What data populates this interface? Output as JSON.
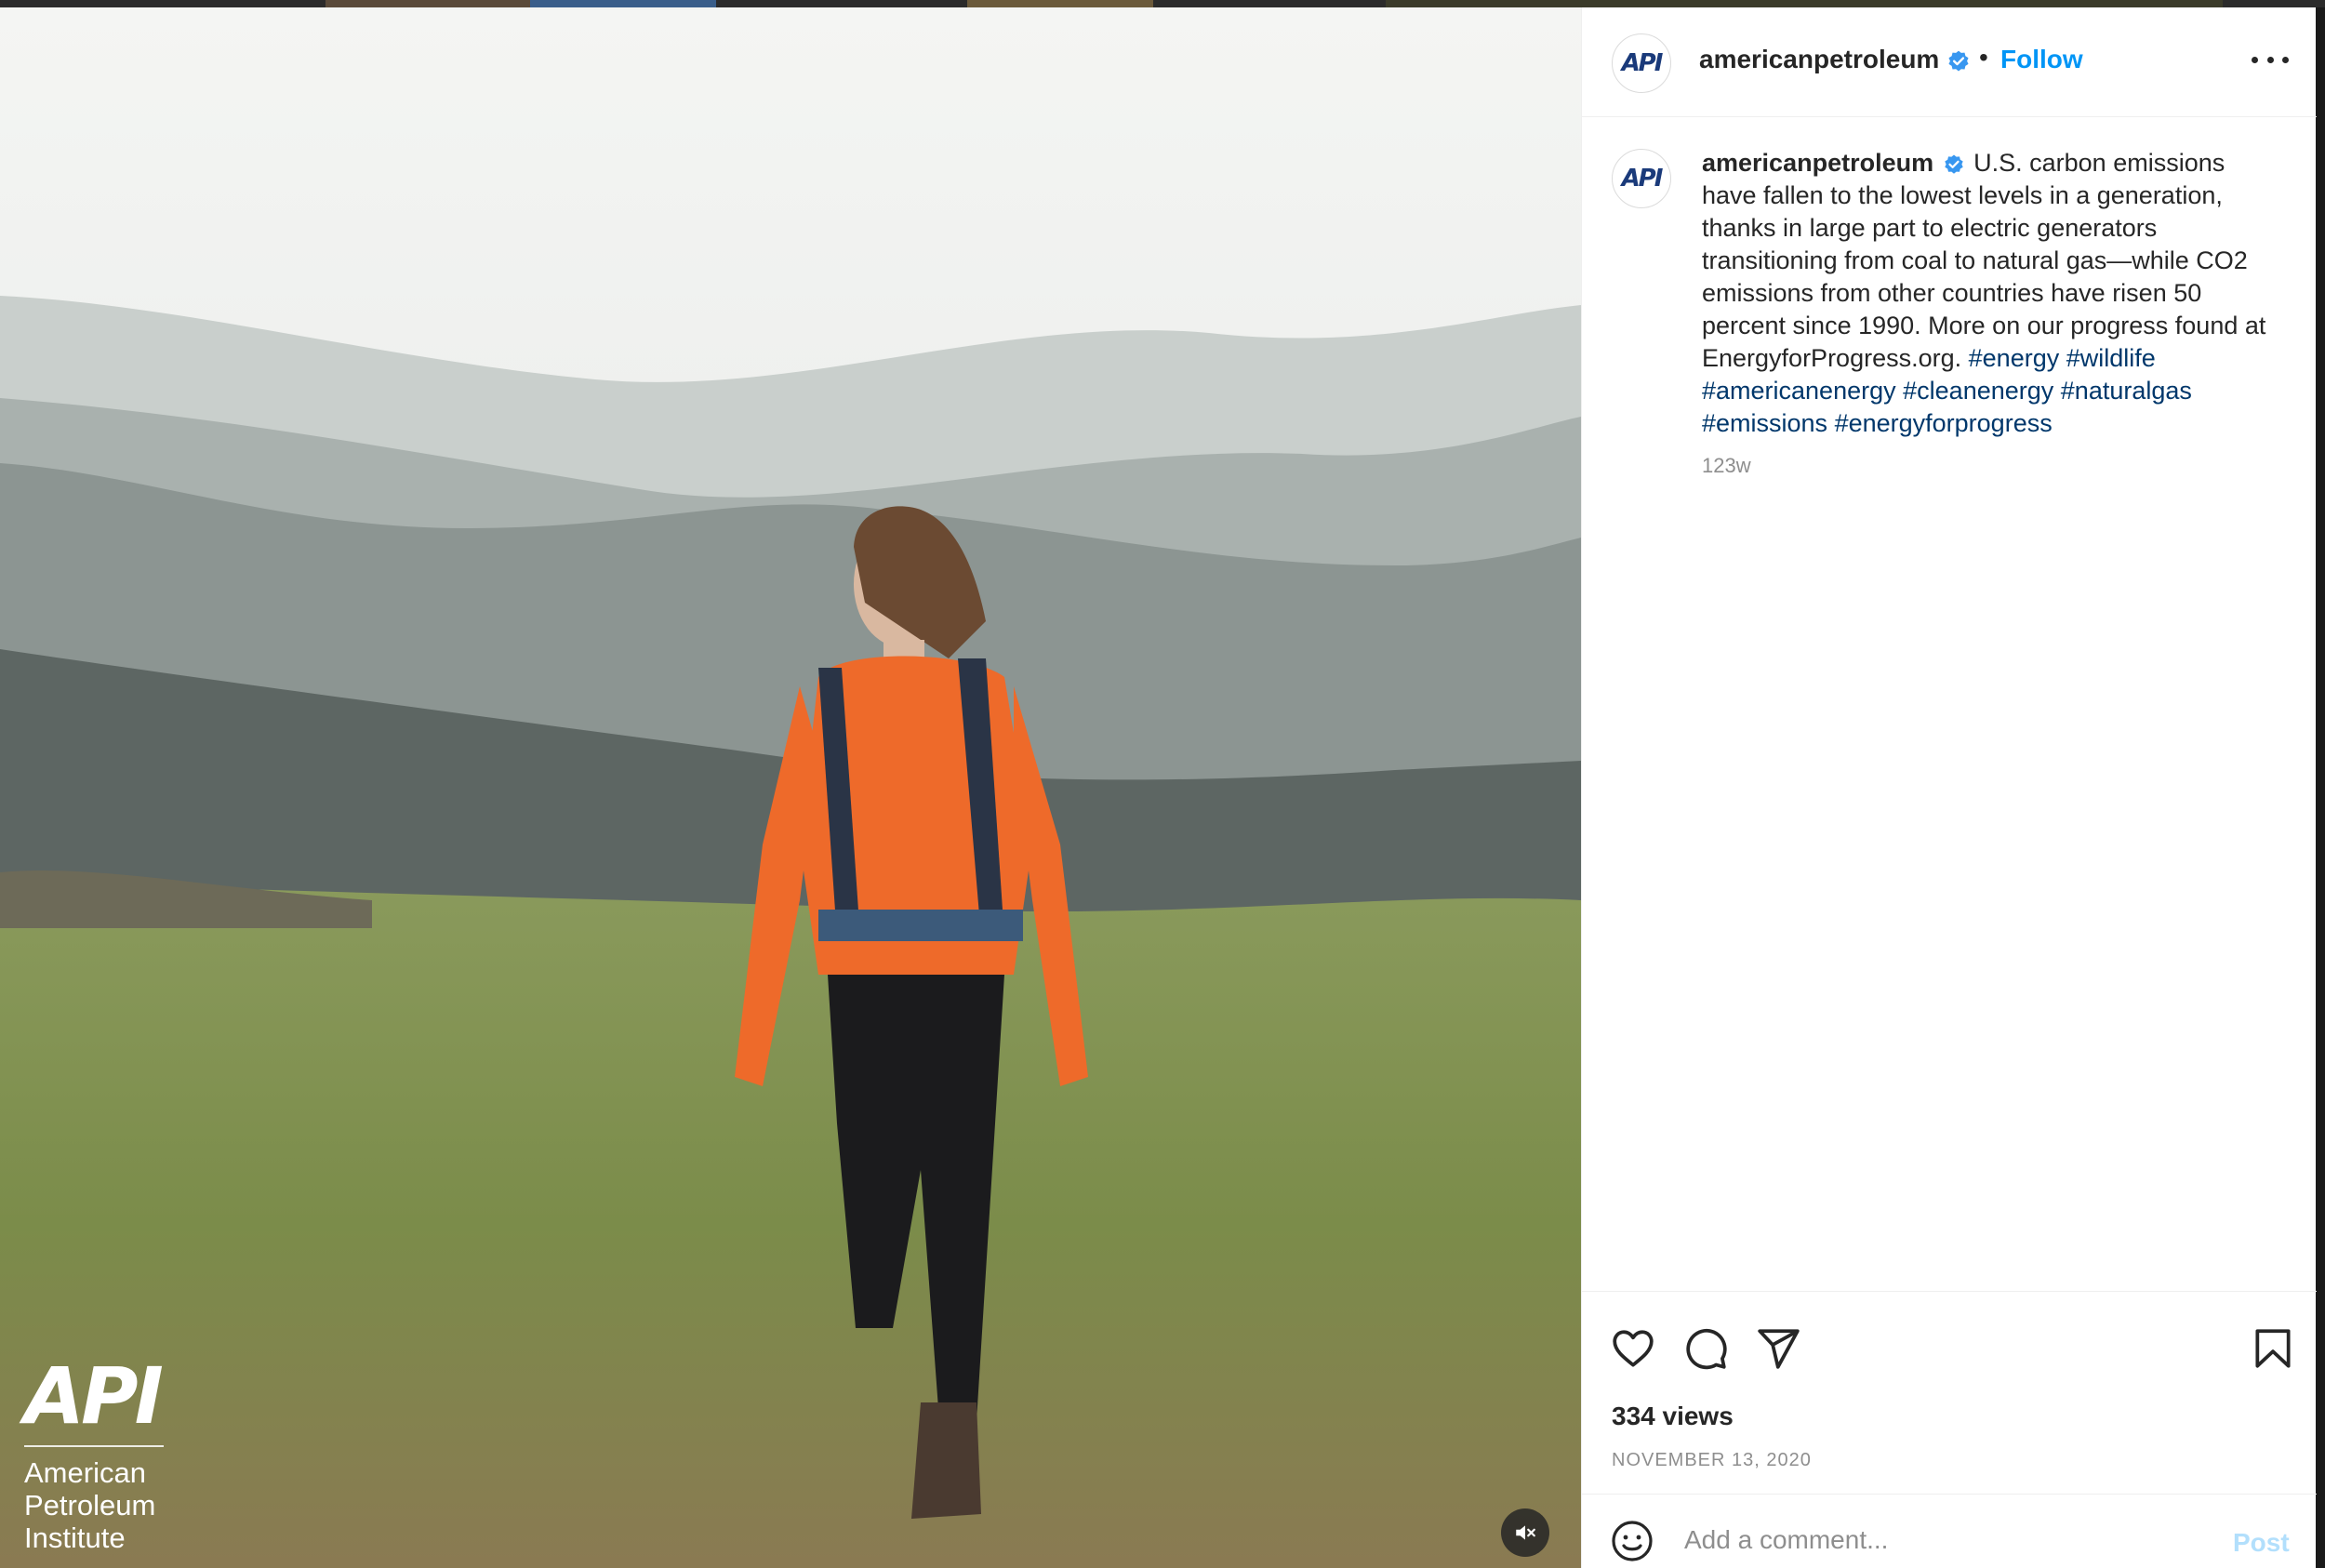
{
  "post": {
    "username": "americanpetroleum",
    "follow_label": "Follow",
    "separator": "•",
    "avatar_text": "API",
    "caption": {
      "username": "americanpetroleum",
      "text": "U.S. carbon emissions have fallen to the lowest levels in a generation, thanks in large part to electric generators transitioning from coal to natural gas—while CO2 emissions from other countries have risen 50 percent since 1990. More on our progress found at EnergyforProgress.org.",
      "hashtags": [
        "#energy",
        "#wildlife",
        "#americanenergy",
        "#cleanenergy",
        "#naturalgas",
        "#emissions",
        "#energyforprogress"
      ],
      "age": "123w"
    },
    "views": "334 views",
    "date": "NOVEMBER 13, 2020"
  },
  "video": {
    "watermark_logo": "API",
    "watermark_lines": [
      "American",
      "Petroleum",
      "Institute"
    ]
  },
  "comment": {
    "placeholder": "Add a comment...",
    "post_label": "Post"
  },
  "icons": {
    "verified": "verified-badge-icon",
    "more": "more-options-icon",
    "like": "heart-icon",
    "comment": "comment-bubble-icon",
    "share": "paper-plane-icon",
    "save": "bookmark-icon",
    "emoji": "emoji-icon",
    "mute": "muted-speaker-icon"
  },
  "colors": {
    "link_blue": "#0095f6",
    "hashtag": "#00376b",
    "verified": "#3897f0",
    "post_disabled": "#b2dffc"
  }
}
